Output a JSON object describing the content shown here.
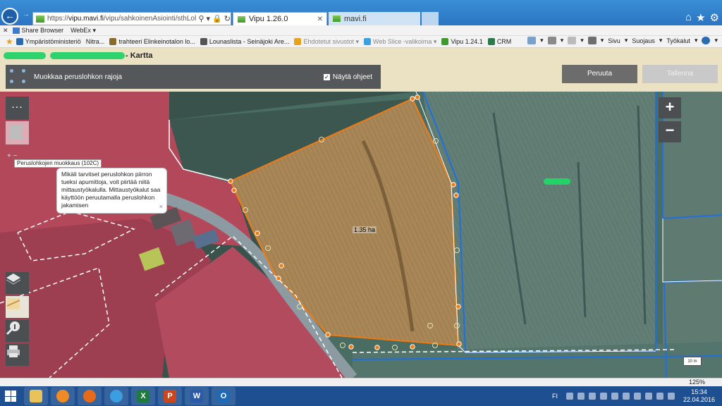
{
  "browser": {
    "url_prefix": "https://",
    "url_host": "vipu.mavi.fi",
    "url_path": "/vipu/sahkoinenAsiointi/sthLohkomuutos",
    "tabs": [
      {
        "label": "Vipu 1.26.0"
      },
      {
        "label": "mavi.fi"
      }
    ]
  },
  "favorites_bar": {
    "items": [
      "Share Browser",
      "WebEx"
    ]
  },
  "bookmarks": [
    {
      "label": "Ympäristöministeriö",
      "color": "#2b6cb0"
    },
    {
      "label": "Nitra...",
      "color": "#2b6cb0",
      "plain": true
    },
    {
      "label": "trahteeri Elinkeinotalon lo...",
      "color": "#8a6a2a"
    },
    {
      "label": "Lounaslista - Seinäjoki Are...",
      "color": "#555555"
    },
    {
      "label": "Ehdotetut sivustot",
      "color": "#e6a21a",
      "dropdown": true,
      "gray": true
    },
    {
      "label": "Web Slice -valikoima",
      "color": "#3aa0e0",
      "dropdown": true,
      "gray": true
    },
    {
      "label": "Vipu 1.24.1",
      "color": "#3e9a2a"
    },
    {
      "label": "CRM",
      "color": "#2a7a4a"
    }
  ],
  "command_bar": {
    "items": [
      "Sivu",
      "Suojaus",
      "Työkalut"
    ]
  },
  "app": {
    "title_suffix": "- Kartta",
    "tool_label": "Muokkaa peruslohkon rajoja",
    "help_toggle_label": "Näytä ohjeet",
    "help_toggle_checked": true,
    "cancel_label": "Peruuta",
    "save_label": "Tallenna"
  },
  "map": {
    "area_label": "1.35 ha",
    "tool_caption": "Peruslohkojen muokkaus (102C)",
    "help_text": "Mikäli tarvitset peruslohkon piirron tueksi apumittoja, voit piirtää niitä mittaustyökalulla. Mittaustyökalut saa käyttöön peruutamalla peruslohkon jakamisen",
    "help_close": "×",
    "more_label": "...",
    "zoom_in": "+",
    "zoom_out": "−",
    "scale_label": "10 m",
    "colors": {
      "edit_boundary": "#f07b12",
      "parcel_boundary": "#ffffff",
      "reference_boundary": "#1f6fe0"
    }
  },
  "status": {
    "zoom_level": "125%"
  },
  "taskbar": {
    "apps": [
      {
        "icon": "file-explorer-icon",
        "color": "#e8c35a"
      },
      {
        "icon": "media-player-icon",
        "color": "#f08a24"
      },
      {
        "icon": "firefox-icon",
        "color": "#e56a1a"
      },
      {
        "icon": "internet-explorer-icon",
        "color": "#3a9ee0"
      },
      {
        "icon": "excel-icon",
        "color": "#1f7a3f",
        "glyph": "X"
      },
      {
        "icon": "powerpoint-icon",
        "color": "#c8471f",
        "glyph": "P"
      },
      {
        "icon": "word-icon",
        "color": "#2a5aa8",
        "glyph": "W"
      },
      {
        "icon": "outlook-icon",
        "color": "#1f6ab8",
        "glyph": "O"
      }
    ],
    "language": "FI",
    "time": "15:34",
    "date": "22.04.2016"
  }
}
